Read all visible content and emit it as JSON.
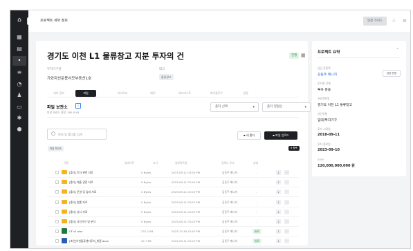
{
  "topbar": {
    "breadcrumb": "프로젝트 세부 정보",
    "action_label": "일정 가이드"
  },
  "project": {
    "title": "경기도 이천 L1 물류창고 지분 투자의 건",
    "status": "진행",
    "meta": [
      {
        "label": "투자기구명",
        "value": "가와자산운용사모부동산1호"
      },
      {
        "label": "태그",
        "tag": "물류창고"
      }
    ]
  },
  "tabs": [
    "세부 정보",
    "파일",
    "히스토리",
    "메모",
    "체크리스트",
    "매각플로우",
    "설정"
  ],
  "active_tab": 1,
  "files_section": {
    "title": "파일 보관소",
    "subtitle": "파일 보관소 용량: 384.8 KB",
    "select_1": "폴더 선택",
    "select_2": "폴더 정렬순",
    "search_placeholder": "파일 및 폴더를 검색",
    "new_folder_label": "새 폴더",
    "upload_label": "파일 업로드",
    "filter_chip": "파일 보관소",
    "count": "8 항목"
  },
  "table": {
    "headers": [
      "이름",
      "업데이트",
      "크기",
      "업데이트일",
      "업로드 유저",
      "상태"
    ],
    "rows": [
      {
        "type": "folder",
        "name": "[폴더] 투자 관련 자료",
        "size": "0 Bytes",
        "date": "2023-09-11 03:50 PM",
        "user": "김동주 매니저",
        "state": "-",
        "pill": false
      },
      {
        "type": "folder",
        "name": "[폴더] 매출 관련 자료",
        "size": "0 Bytes",
        "date": "2023-09-11 03:49 PM",
        "user": "김동주 매니저",
        "state": "-",
        "pill": false
      },
      {
        "type": "folder",
        "name": "[폴더] 운영 및 임대 자료",
        "size": "0 Bytes",
        "date": "2023-09-11 03:23 PM",
        "user": "김동주 매니저",
        "state": "-",
        "pill": false
      },
      {
        "type": "folder",
        "name": "[폴더] 법률 자료",
        "size": "0 Bytes",
        "date": "2023-09-11 03:23 PM",
        "user": "김동주 매니저",
        "state": "-",
        "pill": false
      },
      {
        "type": "folder",
        "name": "[폴더] 실사 자료",
        "size": "0 Bytes",
        "date": "2023-09-11 03:23 PM",
        "user": "김동주 매니저",
        "state": "-",
        "pill": false
      },
      {
        "type": "folder",
        "name": "[폴더] 자산가치 및 분석",
        "size": "0 Bytes",
        "date": "2023-09-11 03:23 PM",
        "user": "김동주 매니저",
        "state": "-",
        "pill": false
      },
      {
        "type": "excel",
        "name": "CF v1.xlsx",
        "size": "231.2 KB",
        "date": "2023-10-18 10:43 PM",
        "user": "김동주 매니저",
        "state": "완료",
        "pill": true
      },
      {
        "type": "word",
        "name": "[초안]이천물류센터투자_최종.docx",
        "size": "22.7 KB",
        "date": "2023-09-11 03:23 PM",
        "user": "김동주 매니저",
        "state": "완료",
        "pill": true
      }
    ]
  },
  "summary": {
    "title": "프로젝트 요약",
    "manager_label": "담당 운용역",
    "manager_value": "김동주 매니저",
    "manager_button": "담당 변경",
    "fields": [
      {
        "label": "투자관 단계",
        "value": "투자 운용"
      },
      {
        "label": "프로젝트명",
        "value": "경기도 이천 L1 물류창고"
      },
      {
        "label": "자산유형",
        "value": "임대/투자기구"
      },
      {
        "label": "투자 시작일",
        "value": "2018-09-11"
      },
      {
        "label": "투자 종료일",
        "value": "2023-09-10"
      },
      {
        "label": "AUM",
        "value": "120,000,000,000 원"
      }
    ]
  }
}
